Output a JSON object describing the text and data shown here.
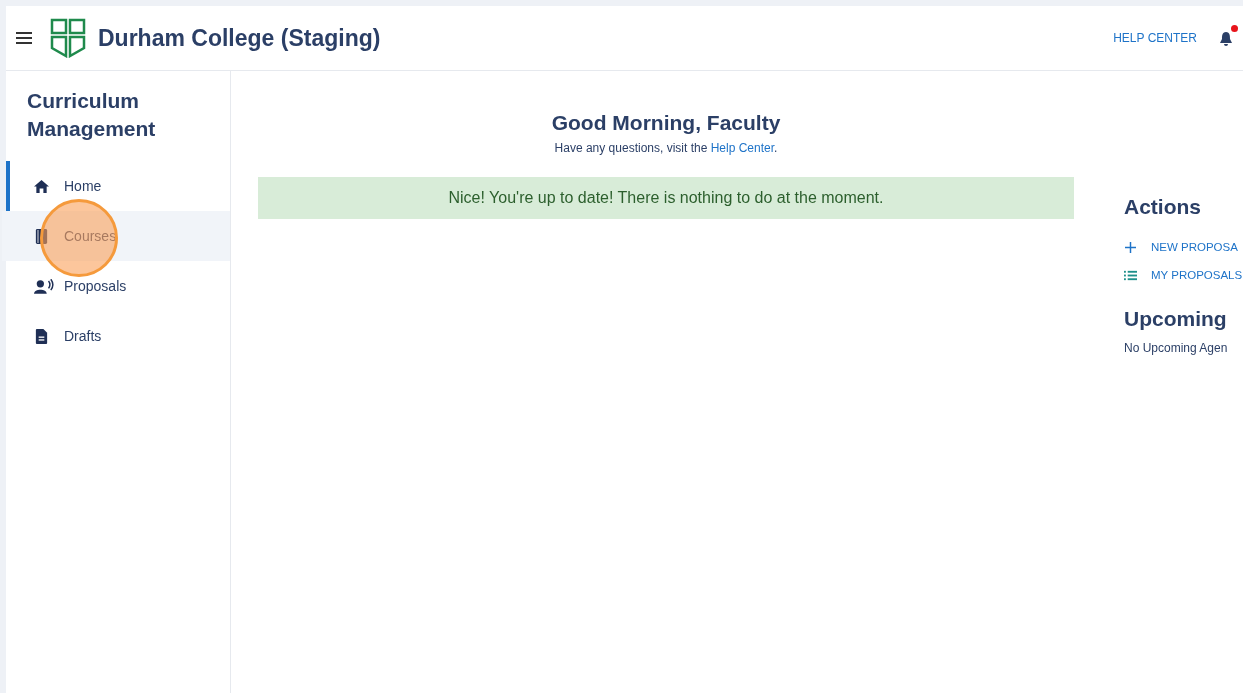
{
  "header": {
    "title": "Durham College (Staging)",
    "help_link": "HELP CENTER",
    "notifications": {
      "unread": true
    }
  },
  "sidebar": {
    "title": "Curriculum Management",
    "items": [
      {
        "label": "Home",
        "kind": "home",
        "selected": true,
        "hovered": false
      },
      {
        "label": "Courses",
        "kind": "book",
        "selected": false,
        "hovered": true
      },
      {
        "label": "Proposals",
        "kind": "speaker",
        "selected": false,
        "hovered": false
      },
      {
        "label": "Drafts",
        "kind": "document",
        "selected": false,
        "hovered": false
      }
    ]
  },
  "click_indicator": {
    "visible": true
  },
  "greeting": {
    "title": "Good Morning, Faculty",
    "subtitle_before": "Have any questions, visit the ",
    "subtitle_link": "Help Center",
    "subtitle_after": "."
  },
  "notice": "Nice! You're up to date! There is nothing to do at the moment.",
  "actions": {
    "title": "Actions",
    "items": [
      {
        "label": "NEW PROPOSA",
        "kind": "plus"
      },
      {
        "label": "MY PROPOSALS",
        "kind": "list"
      }
    ]
  },
  "upcoming": {
    "title": "Upcoming",
    "empty_text": "No Upcoming Agen"
  }
}
